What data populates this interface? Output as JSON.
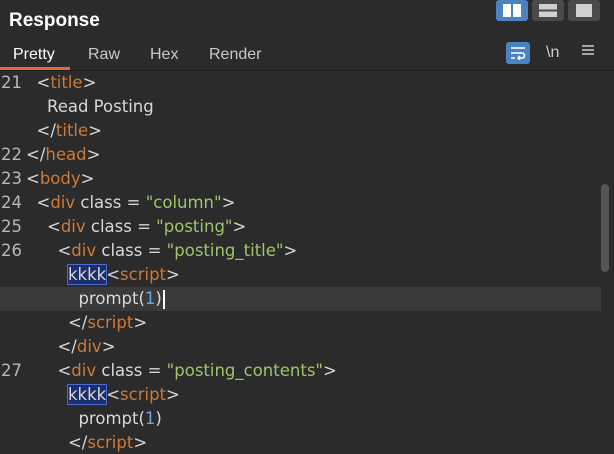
{
  "panel": {
    "title": "Response"
  },
  "tabs": [
    "Pretty",
    "Raw",
    "Hex",
    "Render"
  ],
  "toolbar": {
    "wrap_icon": "wrap-lines-icon",
    "newline_label": "\\n",
    "menu_icon": "hamburger-menu-icon"
  },
  "layout_buttons": [
    "split-columns-icon",
    "split-rows-icon",
    "single-view-icon"
  ],
  "lines": [
    {
      "n": "21",
      "segs": [
        [
          "p",
          "  "
        ],
        [
          "p",
          "<"
        ],
        [
          "t",
          "title"
        ],
        [
          "p",
          ">"
        ]
      ]
    },
    {
      "n": "",
      "segs": [
        [
          "p",
          "    Read Posting"
        ]
      ]
    },
    {
      "n": "",
      "segs": [
        [
          "p",
          "  "
        ],
        [
          "p",
          "</"
        ],
        [
          "t",
          "title"
        ],
        [
          "p",
          ">"
        ]
      ]
    },
    {
      "n": "22",
      "segs": [
        [
          "p",
          "</"
        ],
        [
          "t",
          "head"
        ],
        [
          "p",
          ">"
        ]
      ]
    },
    {
      "n": "23",
      "segs": [
        [
          "p",
          "<"
        ],
        [
          "t",
          "body"
        ],
        [
          "p",
          ">"
        ]
      ]
    },
    {
      "n": "24",
      "segs": [
        [
          "p",
          "  <"
        ],
        [
          "t",
          "div"
        ],
        [
          "a",
          " class = "
        ],
        [
          "s",
          "\"column\""
        ],
        [
          "p",
          ">"
        ]
      ]
    },
    {
      "n": "25",
      "segs": [
        [
          "p",
          "    <"
        ],
        [
          "t",
          "div"
        ],
        [
          "a",
          " class = "
        ],
        [
          "s",
          "\"posting\""
        ],
        [
          "p",
          ">"
        ]
      ]
    },
    {
      "n": "26",
      "segs": [
        [
          "p",
          "      <"
        ],
        [
          "t",
          "div"
        ],
        [
          "a",
          " class = "
        ],
        [
          "s",
          "\"posting_title\""
        ],
        [
          "p",
          ">"
        ]
      ]
    },
    {
      "n": "",
      "segs": [
        [
          "p",
          "        "
        ],
        [
          "h",
          "kkkk"
        ],
        [
          "p",
          "<"
        ],
        [
          "t",
          "script"
        ],
        [
          "p",
          ">"
        ]
      ]
    },
    {
      "n": "",
      "current": true,
      "segs": [
        [
          "p",
          "          prompt("
        ],
        [
          "nm",
          "1"
        ],
        [
          "p",
          ")"
        ],
        [
          "c",
          ""
        ]
      ]
    },
    {
      "n": "",
      "segs": [
        [
          "p",
          "        </"
        ],
        [
          "t",
          "script"
        ],
        [
          "p",
          ">"
        ]
      ]
    },
    {
      "n": "",
      "segs": [
        [
          "p",
          "      </"
        ],
        [
          "t",
          "div"
        ],
        [
          "p",
          ">"
        ]
      ]
    },
    {
      "n": "27",
      "segs": [
        [
          "p",
          "      <"
        ],
        [
          "t",
          "div"
        ],
        [
          "a",
          " class = "
        ],
        [
          "s",
          "\"posting_contents\""
        ],
        [
          "p",
          ">"
        ]
      ]
    },
    {
      "n": "",
      "segs": [
        [
          "p",
          "        "
        ],
        [
          "h",
          "kkkk"
        ],
        [
          "p",
          "<"
        ],
        [
          "t",
          "script"
        ],
        [
          "p",
          ">"
        ]
      ]
    },
    {
      "n": "",
      "segs": [
        [
          "p",
          "          prompt("
        ],
        [
          "nm",
          "1"
        ],
        [
          "p",
          ")"
        ]
      ]
    },
    {
      "n": "",
      "segs": [
        [
          "p",
          "        </"
        ],
        [
          "t",
          "script"
        ],
        [
          "p",
          ">"
        ]
      ]
    }
  ]
}
